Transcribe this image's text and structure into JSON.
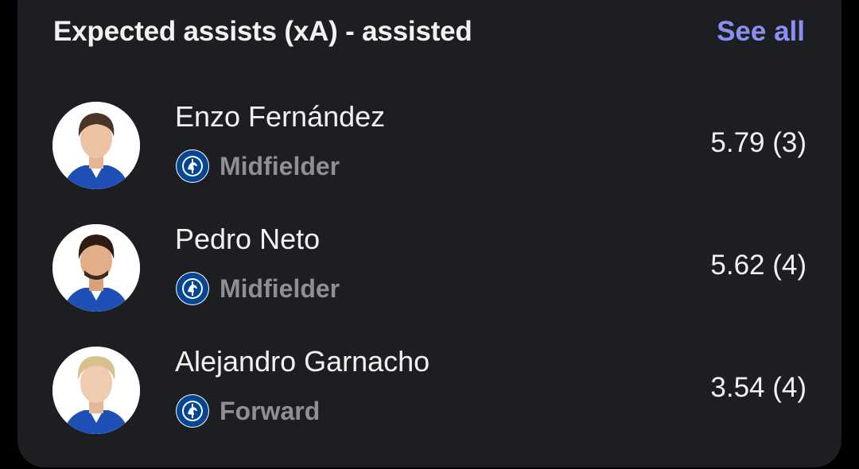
{
  "card": {
    "title": "Expected assists (xA) - assisted",
    "see_all_label": "See all"
  },
  "players": [
    {
      "name": "Enzo Fernández",
      "position": "Midfielder",
      "club_icon": "chelsea-badge-icon",
      "stat": "5.79 (3)",
      "hair_color": "#4a3528"
    },
    {
      "name": "Pedro Neto",
      "position": "Midfielder",
      "club_icon": "chelsea-badge-icon",
      "stat": "5.62 (4)",
      "hair_color": "#2c1d14"
    },
    {
      "name": "Alejandro Garnacho",
      "position": "Forward",
      "club_icon": "chelsea-badge-icon",
      "stat": "3.54 (4)",
      "hair_color": "#d8c08c"
    }
  ],
  "colors": {
    "card_background": "#1c1e21",
    "accent": "#8b8ef5",
    "primary_text": "#f2f2f2",
    "secondary_text": "#8e9094",
    "club_blue": "#034694"
  }
}
